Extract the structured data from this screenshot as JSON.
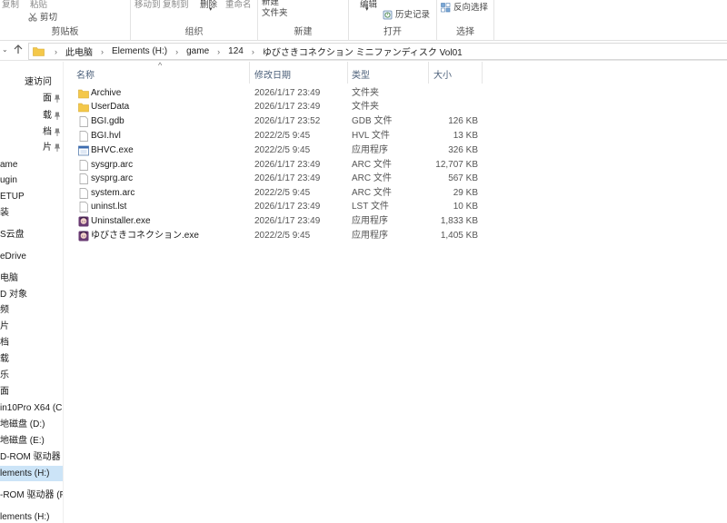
{
  "ribbon": {
    "clipboard": {
      "label": "剪贴板",
      "copy": "复制",
      "paste": "粘贴",
      "cut": "剪切"
    },
    "organize": {
      "label": "组织",
      "move_to": "移动到",
      "copy_to": "复制到",
      "delete": "删除",
      "rename": "重命名"
    },
    "new": {
      "label": "新建",
      "new_folder_line1": "新建",
      "new_folder_line2": "文件夹"
    },
    "open": {
      "label": "打开",
      "edit": "编辑",
      "history": "历史记录"
    },
    "select": {
      "label": "选择",
      "invert": "反向选择"
    }
  },
  "address": {
    "crumbs": [
      "此电脑",
      "Elements (H:)",
      "game",
      "124",
      "ゆびさきコネクション ミニファンディスク Vol01"
    ]
  },
  "nav": {
    "items": [
      {
        "label": "速访问",
        "pinned": false
      },
      {
        "label": "面",
        "pinned": true
      },
      {
        "label": "载",
        "pinned": true
      },
      {
        "label": "档",
        "pinned": true
      },
      {
        "label": "片",
        "pinned": true
      },
      {
        "label": "ame",
        "pinned": false
      },
      {
        "label": "ugin",
        "pinned": false
      },
      {
        "label": "ETUP",
        "pinned": false
      },
      {
        "label": "装",
        "pinned": false
      },
      {
        "label": "S云盘",
        "pinned": false
      },
      {
        "label": "eDrive",
        "pinned": false
      },
      {
        "label": "电脑",
        "pinned": false
      },
      {
        "label": "D 对象",
        "pinned": false
      },
      {
        "label": "频",
        "pinned": false
      },
      {
        "label": "片",
        "pinned": false
      },
      {
        "label": "档",
        "pinned": false
      },
      {
        "label": "载",
        "pinned": false
      },
      {
        "label": "乐",
        "pinned": false
      },
      {
        "label": "面",
        "pinned": false
      },
      {
        "label": "in10Pro X64 (C:)",
        "pinned": false
      },
      {
        "label": "地磁盘 (D:)",
        "pinned": false
      },
      {
        "label": "地磁盘 (E:)",
        "pinned": false
      },
      {
        "label": "D-ROM 驱动器 (F:)",
        "pinned": false
      },
      {
        "label": "lements (H:)",
        "pinned": false,
        "selected": true
      },
      {
        "label": "-ROM 驱动器 (F:)",
        "pinned": false
      },
      {
        "label": "lements (H:)",
        "pinned": false
      }
    ]
  },
  "list": {
    "headers": {
      "name": "名称",
      "date": "修改日期",
      "type": "类型",
      "size": "大小"
    },
    "rows": [
      {
        "name": "Archive",
        "date": "2026/1/17 23:49",
        "type": "文件夹",
        "size": "",
        "icon": "folder-icon"
      },
      {
        "name": "UserData",
        "date": "2026/1/17 23:49",
        "type": "文件夹",
        "size": "",
        "icon": "folder-icon"
      },
      {
        "name": "BGI.gdb",
        "date": "2026/1/17 23:52",
        "type": "GDB 文件",
        "size": "126 KB",
        "icon": "file-icon"
      },
      {
        "name": "BGI.hvl",
        "date": "2022/2/5 9:45",
        "type": "HVL 文件",
        "size": "13 KB",
        "icon": "file-icon"
      },
      {
        "name": "BHVC.exe",
        "date": "2022/2/5 9:45",
        "type": "应用程序",
        "size": "326 KB",
        "icon": "exe-window-icon"
      },
      {
        "name": "sysgrp.arc",
        "date": "2026/1/17 23:49",
        "type": "ARC 文件",
        "size": "12,707 KB",
        "icon": "file-icon"
      },
      {
        "name": "sysprg.arc",
        "date": "2026/1/17 23:49",
        "type": "ARC 文件",
        "size": "567 KB",
        "icon": "file-icon"
      },
      {
        "name": "system.arc",
        "date": "2022/2/5 9:45",
        "type": "ARC 文件",
        "size": "29 KB",
        "icon": "file-icon"
      },
      {
        "name": "uninst.lst",
        "date": "2026/1/17 23:49",
        "type": "LST 文件",
        "size": "10 KB",
        "icon": "file-icon"
      },
      {
        "name": "Uninstaller.exe",
        "date": "2026/1/17 23:49",
        "type": "应用程序",
        "size": "1,833 KB",
        "icon": "app-character-icon"
      },
      {
        "name": "ゆびさきコネクション.exe",
        "date": "2022/2/5 9:45",
        "type": "应用程序",
        "size": "1,405 KB",
        "icon": "app-character-icon"
      }
    ]
  },
  "colors": {
    "selection": "#cce4f7",
    "folder": "#f4c84a",
    "header_text": "#4c607a"
  }
}
